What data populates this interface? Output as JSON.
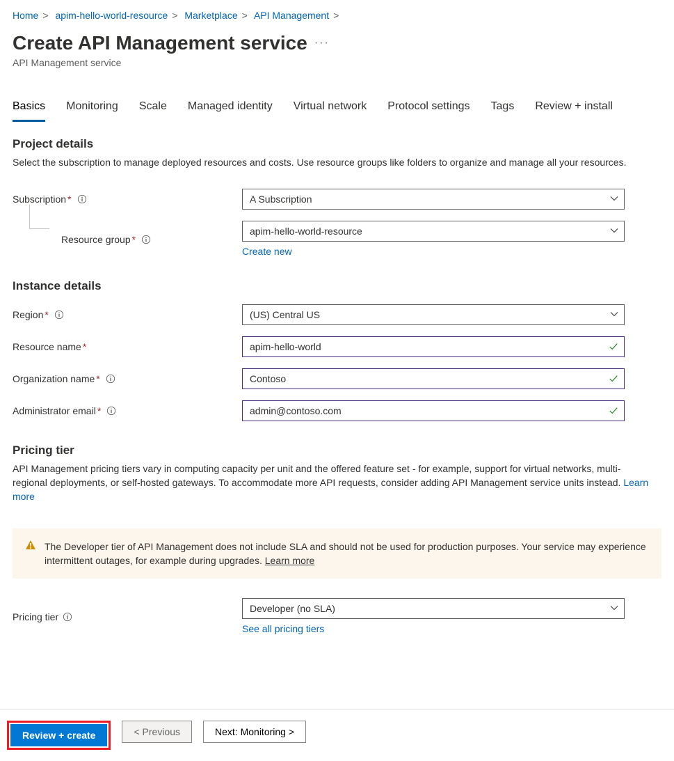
{
  "breadcrumb": [
    {
      "label": "Home",
      "link": true
    },
    {
      "label": "apim-hello-world-resource",
      "link": true
    },
    {
      "label": "Marketplace",
      "link": true
    },
    {
      "label": "API Management",
      "link": true
    }
  ],
  "title": "Create API Management service",
  "subtitle": "API Management service",
  "tabs": [
    {
      "label": "Basics",
      "active": true
    },
    {
      "label": "Monitoring"
    },
    {
      "label": "Scale"
    },
    {
      "label": "Managed identity"
    },
    {
      "label": "Virtual network"
    },
    {
      "label": "Protocol settings"
    },
    {
      "label": "Tags"
    },
    {
      "label": "Review + install"
    }
  ],
  "project": {
    "title": "Project details",
    "desc": "Select the subscription to manage deployed resources and costs. Use resource groups like folders to organize and manage all your resources.",
    "subscription_label": "Subscription",
    "subscription_value": "A Subscription",
    "rg_label": "Resource group",
    "rg_value": "apim-hello-world-resource",
    "create_new": "Create new"
  },
  "instance": {
    "title": "Instance details",
    "region_label": "Region",
    "region_value": "(US) Central US",
    "name_label": "Resource name",
    "name_value": "apim-hello-world",
    "org_label": "Organization name",
    "org_value": "Contoso",
    "email_label": "Administrator email",
    "email_value": "admin@contoso.com"
  },
  "pricing": {
    "title": "Pricing tier",
    "desc": "API Management pricing tiers vary in computing capacity per unit and the offered feature set - for example, support for virtual networks, multi-regional deployments, or self-hosted gateways. To accommodate more API requests, consider adding API Management service units instead.",
    "learn_more": "Learn more",
    "warning": "The Developer tier of API Management does not include SLA and should not be used for production purposes. Your service may experience intermittent outages, for example during upgrades.",
    "warning_learn": "Learn more",
    "tier_label": "Pricing tier",
    "tier_value": "Developer (no SLA)",
    "see_all": "See all pricing tiers"
  },
  "footer": {
    "review": "Review + create",
    "previous": "< Previous",
    "next": "Next: Monitoring >"
  }
}
